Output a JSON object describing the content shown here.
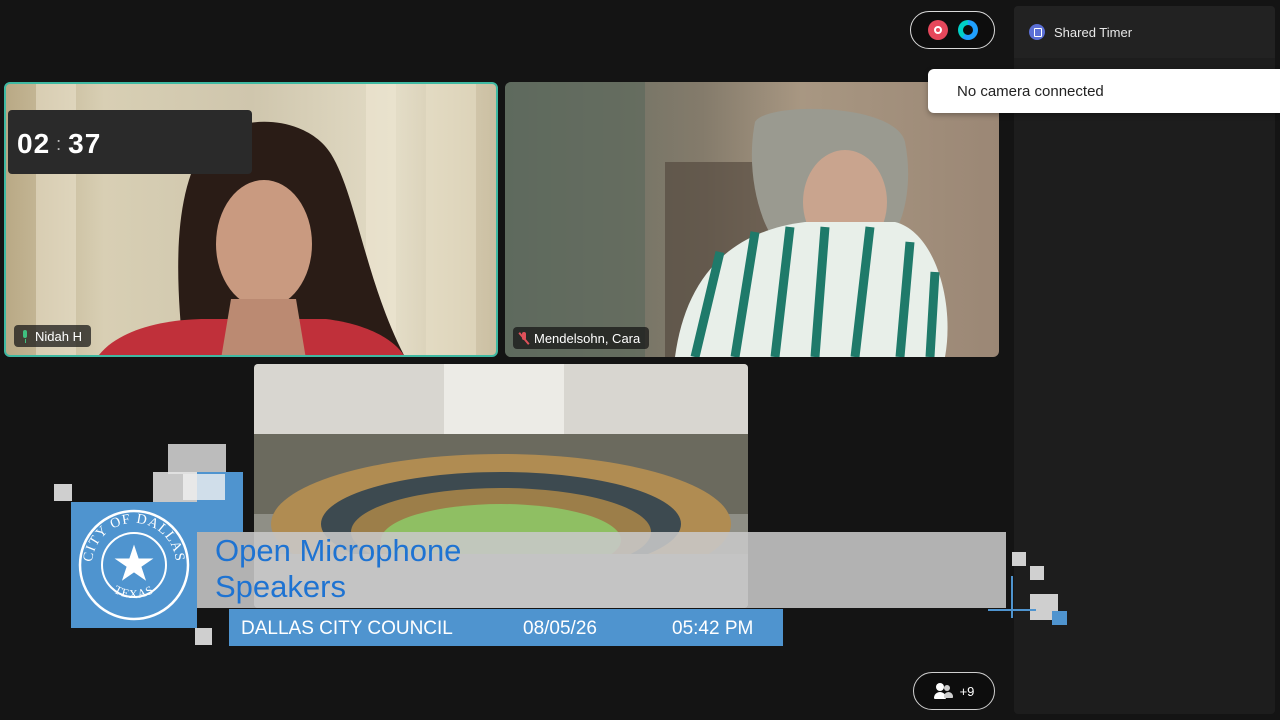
{
  "participants": [
    {
      "name": "Nidah H",
      "mic": "on"
    },
    {
      "name": "Mendelsohn, Cara",
      "mic": "muted"
    }
  ],
  "toolbar": {
    "record_icon": "record-icon",
    "assistant_icon": "ai-assistant-icon",
    "participants_count": "+9"
  },
  "side_panel": {
    "title": "Shared Timer",
    "timer_minutes": "02",
    "timer_separator": ":",
    "timer_seconds": "37"
  },
  "notification": {
    "message": "No camera connected"
  },
  "lower_third": {
    "seal_text_top": "CITY OF DALLAS",
    "seal_text_bottom": "TEXAS",
    "title_line1": "Open Microphone",
    "title_line2": "Speakers",
    "organization": "DALLAS CITY COUNCIL",
    "date": "08/05/26",
    "time": "05:42 PM"
  },
  "colors": {
    "active_speaker_border": "#3fb9a2",
    "broadcast_blue": "#4f94cf",
    "title_text": "#1e73d2",
    "record_red": "#e6475b"
  }
}
